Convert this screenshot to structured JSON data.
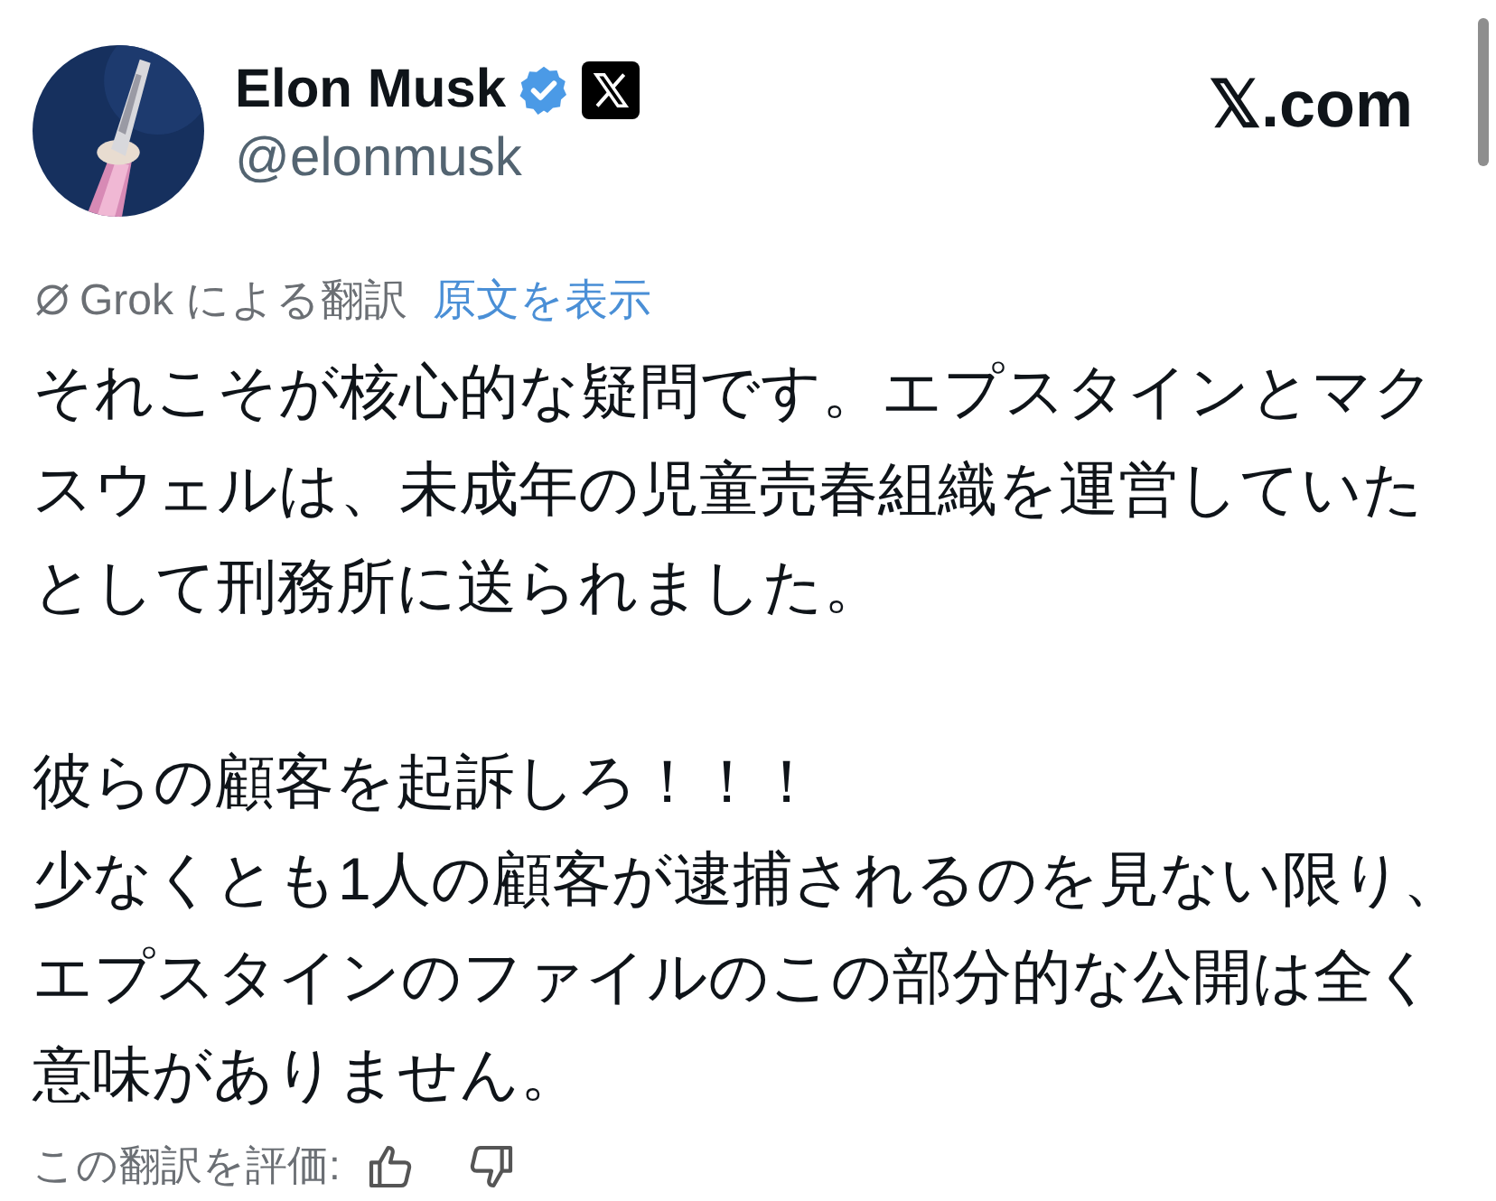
{
  "author": {
    "name": "Elon Musk",
    "handle": "@elonmusk",
    "verified": true
  },
  "site": "𝕏.com",
  "translation": {
    "label": "Grok による翻訳",
    "link": "原文を表示"
  },
  "paragraphs": [
    {
      "lines": [
        "それこそが核心的な疑問です。エプスタインとマクスウェルは、未成年の児童売春組織を運営していたとして刑務所に送られました。"
      ]
    },
    {
      "lines": [
        "彼らの顧客を起訴しろ！！！",
        "少なくとも1人の顧客が逮捕されるのを見ない限り、エプスタインのファイルのこの部分的な公開は全く意味がありません。"
      ]
    }
  ],
  "rating": {
    "label": "この翻訳を評価:"
  }
}
